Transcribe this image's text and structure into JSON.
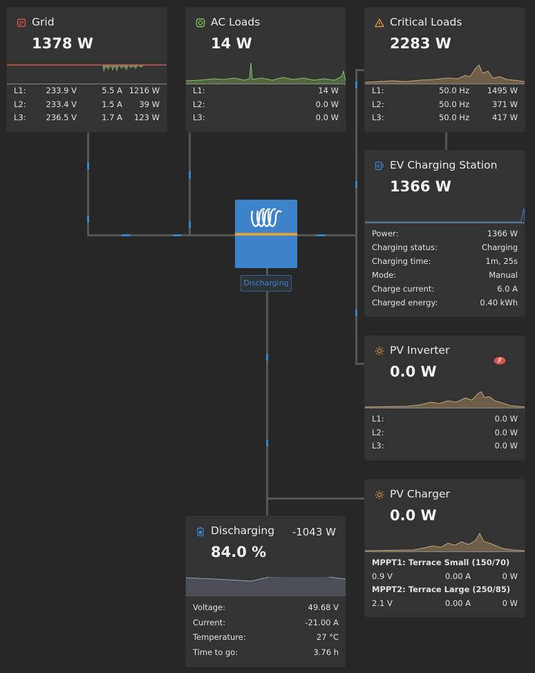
{
  "grid": {
    "title": "Grid",
    "power": "1378 W",
    "icon": "grid-meter-icon",
    "phases": [
      {
        "label": "L1:",
        "voltage": "233.9 V",
        "current": "5.5 A",
        "power": "1216 W"
      },
      {
        "label": "L2:",
        "voltage": "233.4 V",
        "current": "1.5 A",
        "power": "39 W"
      },
      {
        "label": "L3:",
        "voltage": "236.5 V",
        "current": "1.7 A",
        "power": "123 W"
      }
    ]
  },
  "ac_loads": {
    "title": "AC Loads",
    "power": "14 W",
    "icon": "plug-socket-icon",
    "phases": [
      {
        "label": "L1:",
        "power": "14 W"
      },
      {
        "label": "L2:",
        "power": "0.0 W"
      },
      {
        "label": "L3:",
        "power": "0.0 W"
      }
    ]
  },
  "critical_loads": {
    "title": "Critical Loads",
    "power": "2283 W",
    "icon": "warning-triangle-icon",
    "phases": [
      {
        "label": "L1:",
        "frequency": "50.0 Hz",
        "power": "1495 W"
      },
      {
        "label": "L2:",
        "frequency": "50.0 Hz",
        "power": "371 W"
      },
      {
        "label": "L3:",
        "frequency": "50.0 Hz",
        "power": "417 W"
      }
    ]
  },
  "ev_station": {
    "title": "EV Charging Station",
    "power": "1366 W",
    "icon": "ev-charger-icon",
    "rows": [
      {
        "label": "Power:",
        "value": "1366 W"
      },
      {
        "label": "Charging status:",
        "value": "Charging"
      },
      {
        "label": "Charging time:",
        "value": "1m, 25s"
      },
      {
        "label": "Mode:",
        "value": "Manual"
      },
      {
        "label": "Charge current:",
        "value": "6.0 A"
      },
      {
        "label": "Charged energy:",
        "value": "0.40 kWh"
      }
    ]
  },
  "inverter": {
    "status": "Discharging",
    "icon": "victron-logo-icon"
  },
  "pv_inverter": {
    "title": "PV Inverter",
    "power": "0.0 W",
    "icon": "sun-icon",
    "badge_icon": "fronius-logo-icon",
    "phases": [
      {
        "label": "L1:",
        "power": "0.0 W"
      },
      {
        "label": "L2:",
        "power": "0.0 W"
      },
      {
        "label": "L3:",
        "power": "0.0 W"
      }
    ]
  },
  "pv_charger": {
    "title": "PV Charger",
    "power": "0.0 W",
    "icon": "sun-icon",
    "mppts": [
      {
        "name": "MPPT1: Terrace Small (150/70)",
        "voltage": "0.9 V",
        "current": "0.00 A",
        "power": "0 W"
      },
      {
        "name": "MPPT2: Terrace Large (250/85)",
        "voltage": "2.1 V",
        "current": "0.00 A",
        "power": "0 W"
      }
    ]
  },
  "battery": {
    "title": "Discharging",
    "power": "-1043 W",
    "soc": "84.0 %",
    "icon": "battery-icon",
    "rows": [
      {
        "label": "Voltage:",
        "value": "49.68 V"
      },
      {
        "label": "Current:",
        "value": "-21.00 A"
      },
      {
        "label": "Temperature:",
        "value": "27 °C"
      },
      {
        "label": "Time to go:",
        "value": "3.76 h"
      }
    ]
  },
  "colors": {
    "background": "#272727",
    "card": "#333333",
    "accent_blue": "#3d83c9",
    "grid_red": "#d9534f",
    "ac_green": "#8bc26a",
    "solar_tan": "#c9a77c",
    "inverter_orange": "#e3a03a"
  }
}
